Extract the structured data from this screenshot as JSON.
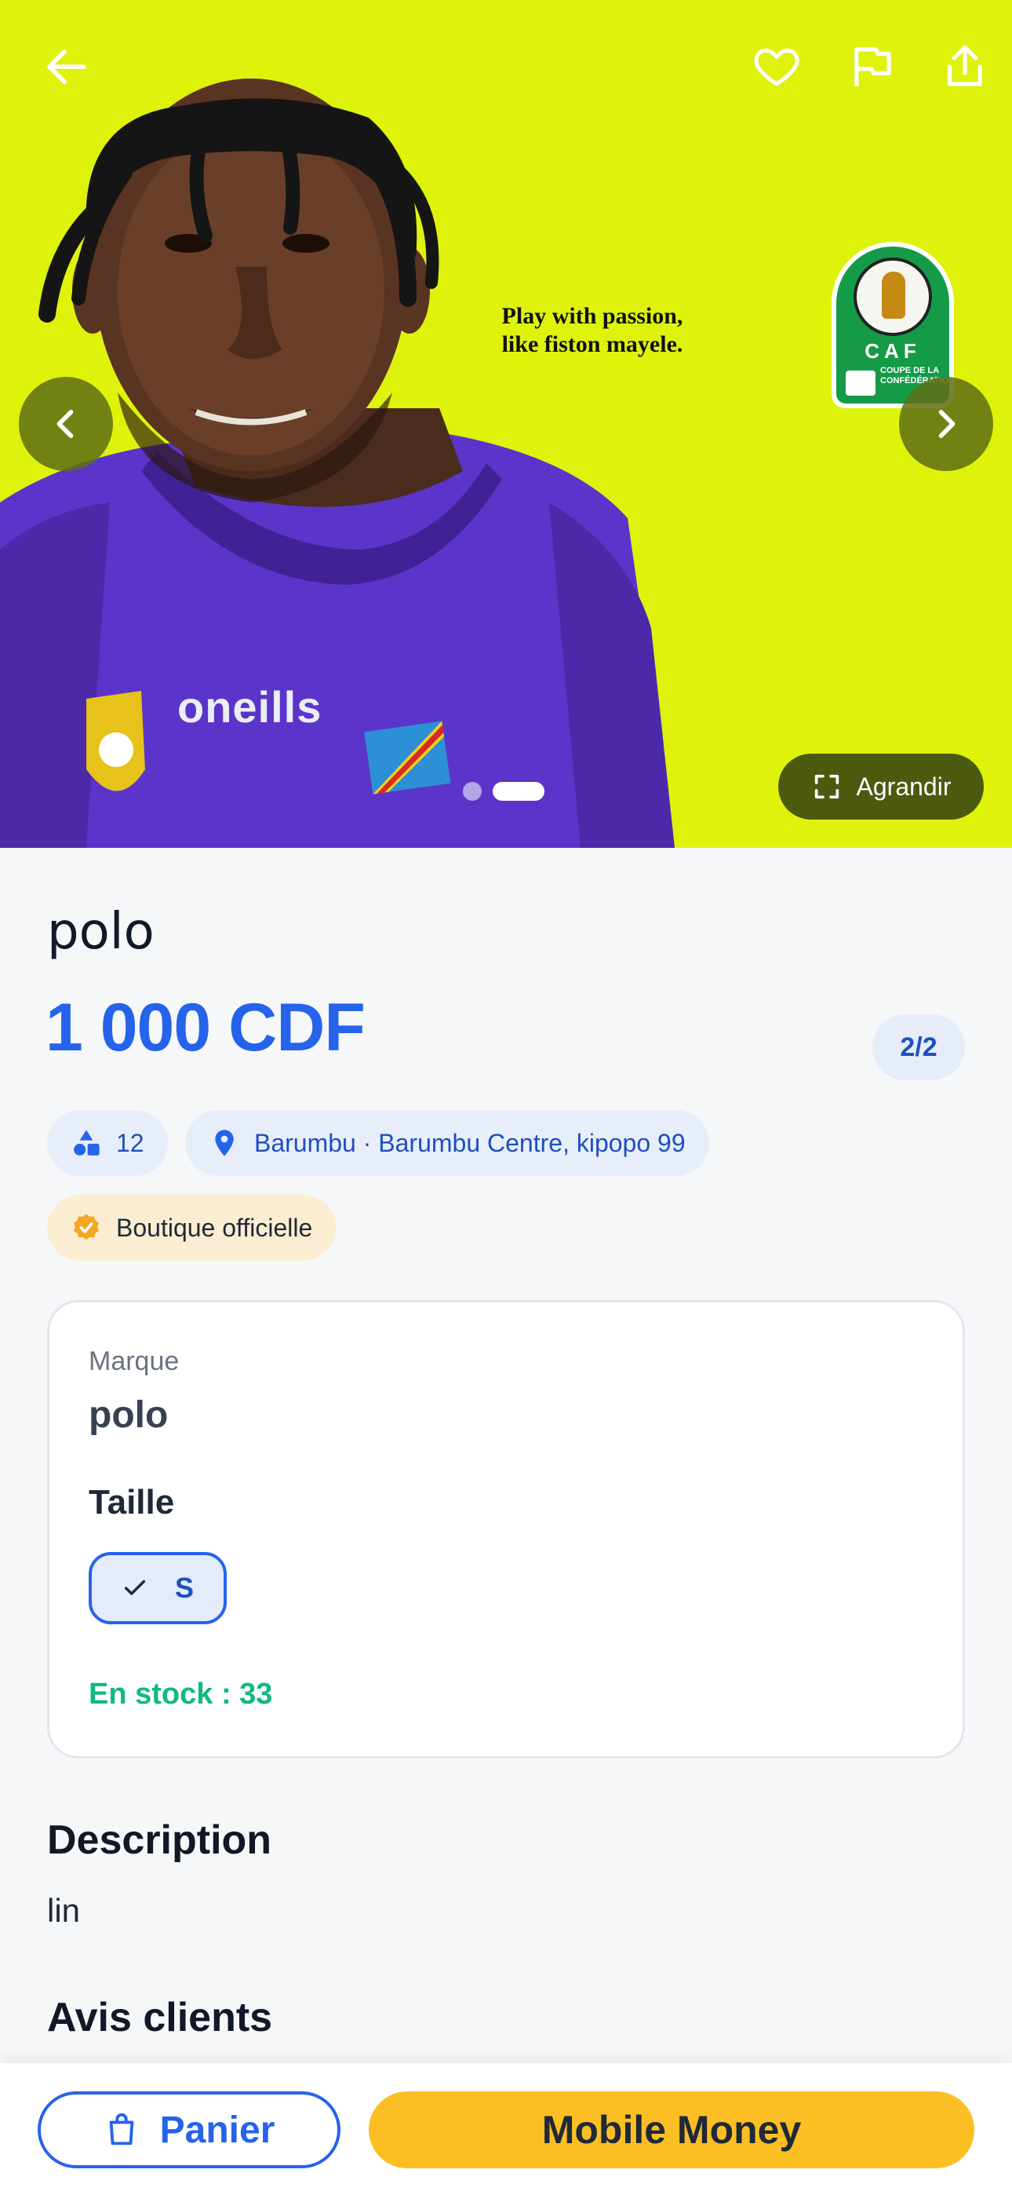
{
  "hero": {
    "slogan_line1": "Play with passion,",
    "slogan_line2": "like fiston mayele.",
    "jersey_brand": "oneills",
    "badge_name": "CAF",
    "badge_sub": "COUPE DE LA CONFÉDÉRATION",
    "enlarge_label": "Agrandir",
    "slides_total": 2,
    "active_slide": 2,
    "background_color": "#dff20b"
  },
  "header_icons": [
    "back-arrow-icon",
    "heart-icon",
    "flag-icon",
    "share-icon"
  ],
  "product": {
    "name": "polo",
    "price": "1 000 CDF",
    "image_counter": "2/2",
    "count": "12",
    "location": "Barumbu · Barumbu Centre, kipopo 99",
    "official_badge": "Boutique officielle"
  },
  "specs": {
    "brand_label": "Marque",
    "brand_value": "polo",
    "size_title": "Taille",
    "size_selected": "S",
    "stock": "En stock : 33"
  },
  "description": {
    "title": "Description",
    "text": "lin"
  },
  "reviews": {
    "title": "Avis clients"
  },
  "actions": {
    "cart_label": "Panier",
    "pay_label": "Mobile Money"
  },
  "colors": {
    "accent": "#2563eb",
    "pay_button": "#fbbf24",
    "stock": "#10b981"
  }
}
